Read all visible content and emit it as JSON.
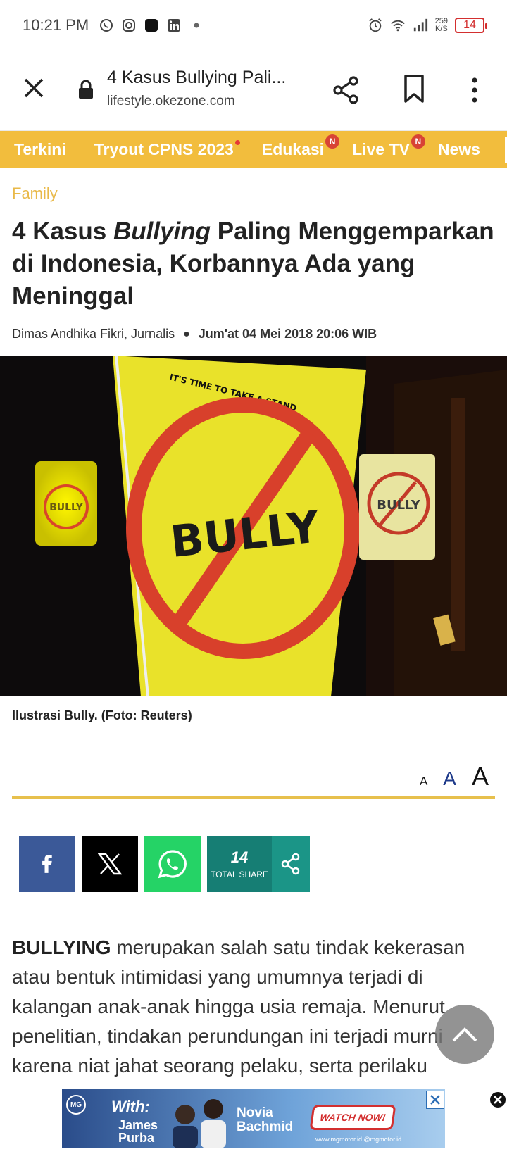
{
  "status_bar": {
    "time": "10:21 PM",
    "net_speed_value": "259",
    "net_speed_unit": "K/S",
    "battery": "14"
  },
  "browser": {
    "page_title": "4 Kasus Bullying Pali...",
    "url": "lifestyle.okezone.com"
  },
  "nav": {
    "items": [
      {
        "label": "Terkini"
      },
      {
        "label": "Tryout CPNS 2023"
      },
      {
        "label": "Edukasi",
        "badge": "N"
      },
      {
        "label": "Live TV",
        "badge": "N"
      },
      {
        "label": "News"
      }
    ]
  },
  "article": {
    "category": "Family",
    "headline_part1": "4 Kasus ",
    "headline_italic": "Bullying",
    "headline_part2": " Paling Menggemparkan di Indonesia, Korbannya Ada yang Meninggal",
    "author": "Dimas Andhika Fikri",
    "author_role": ", Jurnalis",
    "date": "Jum'at 04 Mei 2018 20:06 WIB",
    "image_sign_top": "IT'S TIME TO TAKE A STAND",
    "image_sign_main": "BULLY",
    "image_sign_left": "BULLY",
    "image_sign_right": "BULLY",
    "caption": "Ilustrasi Bully. (Foto: Reuters)",
    "body_lead": "BULLYING",
    "body_text": " merupakan salah satu tindak kekerasan atau bentuk intimidasi yang umumnya terjadi di kalangan anak-anak hingga usia remaja. Menurut penelitian, tindakan perundungan ini terjadi murni karena niat jahat seorang pelaku, serta perilaku"
  },
  "font_controls": {
    "small": "A",
    "medium": "A",
    "large": "A"
  },
  "share": {
    "total_count": "14",
    "total_label": "TOTAL SHARE"
  },
  "ad": {
    "brand": "MG",
    "with_text": "With:",
    "name1_first": "James",
    "name1_last": "Purba",
    "name2_first": "Novia",
    "name2_last": "Bachmid",
    "cta": "WATCH NOW!",
    "footer": "www.mgmotor.id  @mgmotor.id"
  },
  "colors": {
    "nav_bg": "#f2bd3d",
    "category": "#e9b949",
    "facebook": "#3b5998",
    "whatsapp": "#25d366",
    "share_teal": "#167e74"
  }
}
